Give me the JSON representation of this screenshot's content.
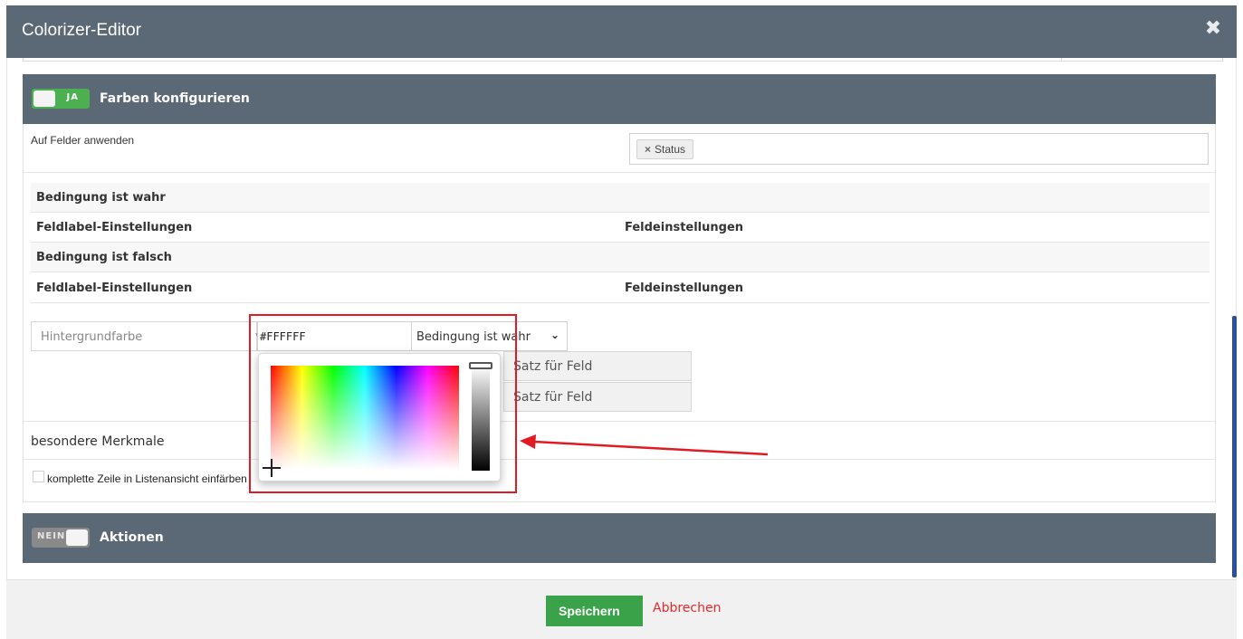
{
  "dialog": {
    "title": "Colorizer-Editor",
    "close_icon": "close-icon"
  },
  "colors_panel": {
    "toggle_label": "JA",
    "title": "Farben konfigurieren",
    "apply_label": "Auf Felder anwenden",
    "tag_remove": "×",
    "tag_value": "Status",
    "rows": [
      {
        "c1": "Bedingung ist wahr",
        "c2": ""
      },
      {
        "c1": "Feldlabel-Einstellungen",
        "c2": "Feldeinstellungen"
      },
      {
        "c1": "Bedingung ist falsch",
        "c2": ""
      },
      {
        "c1": "Feldlabel-Einstellungen",
        "c2": "Feldeinstellungen"
      }
    ],
    "property_select": "Hintergrundfarbe",
    "hex_value": "#FFFFFF",
    "condition_select": "Bedingung ist wahr",
    "buttons": [
      "Satz für Feld",
      "Satz für Feld"
    ],
    "special_label": "besondere Merkmale",
    "checkbox_label": "komplette Zeile in Listenansicht einfärben"
  },
  "actions_panel": {
    "toggle_label": "NEIN",
    "title": "Aktionen"
  },
  "footer": {
    "save": "Speichern",
    "cancel": "Abbrechen"
  },
  "colors": {
    "header": "#5b6875",
    "save": "#3aa34a",
    "cancel": "#e22b2b",
    "annotation": "#e01b24"
  }
}
